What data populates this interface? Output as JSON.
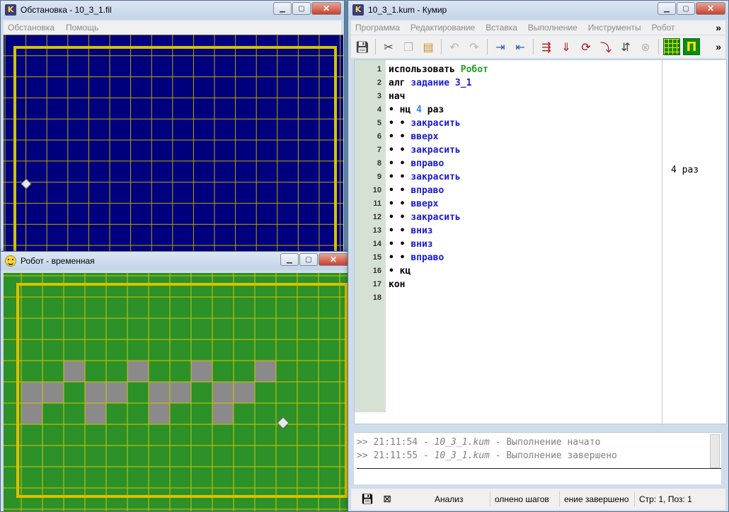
{
  "env_window": {
    "title": "Обстановка - 10_3_1.fil",
    "menu": [
      "Обстановка",
      "Помощь"
    ]
  },
  "robot_window": {
    "title": "Робот - временная"
  },
  "kumir_window": {
    "title": "10_3_1.kum - Кумир",
    "menu": [
      "Программа",
      "Редактирование",
      "Вставка",
      "Выполнение",
      "Инструменты",
      "Робот"
    ],
    "more": "»",
    "toolbar_icons": [
      "save-icon",
      "cut-icon",
      "copy-icon",
      "paste-icon",
      "undo-icon",
      "redo-icon",
      "indent-icon",
      "unindent-icon",
      "run-icon",
      "step-icon",
      "step-into-icon",
      "step-out-icon",
      "step-back-icon",
      "stop-icon",
      "robot-field-icon",
      "draw-icon"
    ],
    "code_lines": [
      {
        "n": "1",
        "parts": [
          {
            "t": "использовать ",
            "c": "kw"
          },
          {
            "t": "Робот",
            "c": "green"
          }
        ]
      },
      {
        "n": "2",
        "parts": [
          {
            "t": "алг ",
            "c": "kw"
          },
          {
            "t": "задание 3_1",
            "c": "blue"
          }
        ]
      },
      {
        "n": "3",
        "parts": [
          {
            "t": "нач",
            "c": "kw"
          }
        ]
      },
      {
        "n": "4",
        "parts": [
          {
            "t": "• ",
            "c": "dot"
          },
          {
            "t": "нц ",
            "c": "kw"
          },
          {
            "t": "4",
            "c": "num"
          },
          {
            "t": " раз",
            "c": "kw"
          }
        ]
      },
      {
        "n": "5",
        "parts": [
          {
            "t": "• • ",
            "c": "dot"
          },
          {
            "t": "закрасить",
            "c": "blue"
          }
        ]
      },
      {
        "n": "6",
        "parts": [
          {
            "t": "• • ",
            "c": "dot"
          },
          {
            "t": "вверх",
            "c": "blue"
          }
        ]
      },
      {
        "n": "7",
        "parts": [
          {
            "t": "• • ",
            "c": "dot"
          },
          {
            "t": "закрасить",
            "c": "blue"
          }
        ]
      },
      {
        "n": "8",
        "parts": [
          {
            "t": "• • ",
            "c": "dot"
          },
          {
            "t": "вправо",
            "c": "blue"
          }
        ]
      },
      {
        "n": "9",
        "parts": [
          {
            "t": "• • ",
            "c": "dot"
          },
          {
            "t": "закрасить",
            "c": "blue"
          }
        ]
      },
      {
        "n": "10",
        "parts": [
          {
            "t": "• • ",
            "c": "dot"
          },
          {
            "t": "вправо",
            "c": "blue"
          }
        ]
      },
      {
        "n": "11",
        "parts": [
          {
            "t": "• • ",
            "c": "dot"
          },
          {
            "t": "вверх",
            "c": "blue"
          }
        ]
      },
      {
        "n": "12",
        "parts": [
          {
            "t": "• • ",
            "c": "dot"
          },
          {
            "t": "закрасить",
            "c": "blue"
          }
        ]
      },
      {
        "n": "13",
        "parts": [
          {
            "t": "• • ",
            "c": "dot"
          },
          {
            "t": "вниз",
            "c": "blue"
          }
        ]
      },
      {
        "n": "14",
        "parts": [
          {
            "t": "• • ",
            "c": "dot"
          },
          {
            "t": "вниз",
            "c": "blue"
          }
        ]
      },
      {
        "n": "15",
        "parts": [
          {
            "t": "• • ",
            "c": "dot"
          },
          {
            "t": "вправо",
            "c": "blue"
          }
        ]
      },
      {
        "n": "16",
        "parts": [
          {
            "t": "• ",
            "c": "dot"
          },
          {
            "t": "кц",
            "c": "kw"
          }
        ]
      },
      {
        "n": "17",
        "parts": [
          {
            "t": "кон",
            "c": "kw"
          }
        ]
      },
      {
        "n": "18",
        "parts": []
      }
    ],
    "margin_text": "4 раз",
    "console": [
      {
        "prefix": ">> 21:11:54 - ",
        "file": "10_3_1.kum",
        "msg": " - Выполнение начато"
      },
      {
        "prefix": ">> 21:11:55 - ",
        "file": "10_3_1.kum",
        "msg": " - Выполнение завершено"
      }
    ],
    "status": {
      "mode": "Анализ",
      "steps": "олнено шагов",
      "state": "ение завершено",
      "position": "Стр: 1, Поз: 1"
    }
  },
  "colors": {
    "env_bg": "#00007e",
    "robot_bg": "#2b9128",
    "wall": "#d8c200",
    "painted": "#8a8a8a"
  }
}
